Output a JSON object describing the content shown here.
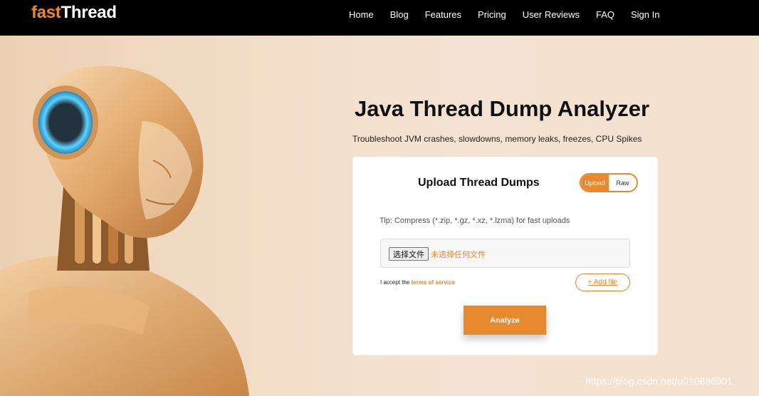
{
  "logo": {
    "part1": "fast",
    "part2": "Thread"
  },
  "nav": {
    "items": [
      "Home",
      "Blog",
      "Features",
      "Pricing",
      "User Reviews",
      "FAQ",
      "Sign In"
    ]
  },
  "hero": {
    "title": "Java Thread Dump Analyzer",
    "subtitle": "Troubleshoot JVM crashes, slowdowns, memory leaks, freezes, CPU Spikes"
  },
  "upload_card": {
    "title": "Upload Thread Dumps",
    "toggle": {
      "upload_label": "Upload",
      "raw_label": "Raw",
      "selected": "Upload"
    },
    "tip": "Tip: Compress (*.zip, *.gz, *.xz, *.lzma) for fast uploads",
    "file_button_label": "选择文件",
    "file_status": "未选择任何文件",
    "accept_text": "I accept the ",
    "terms_link": "terms of service",
    "add_file_label": "+ Add file",
    "analyze_label": "Analyze"
  },
  "watermark": "https://blog.csdn.net/u010886901",
  "colors": {
    "accent": "#e8892f",
    "header_bg": "#000000",
    "card_bg": "#ffffff"
  }
}
